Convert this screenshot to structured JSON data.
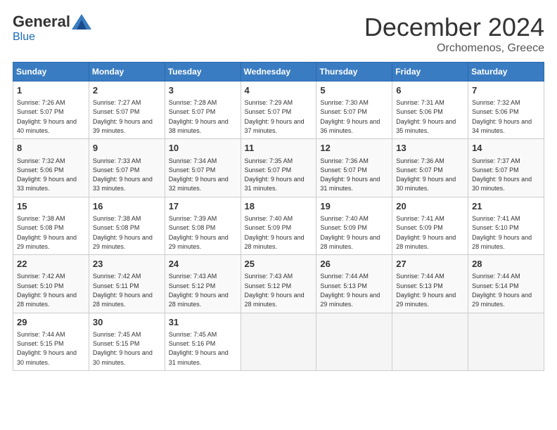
{
  "header": {
    "logo_general": "General",
    "logo_blue": "Blue",
    "month_title": "December 2024",
    "subtitle": "Orchomenos, Greece"
  },
  "days_of_week": [
    "Sunday",
    "Monday",
    "Tuesday",
    "Wednesday",
    "Thursday",
    "Friday",
    "Saturday"
  ],
  "weeks": [
    [
      {
        "day": 1,
        "sunrise": "7:26 AM",
        "sunset": "5:07 PM",
        "daylight": "9 hours and 40 minutes"
      },
      {
        "day": 2,
        "sunrise": "7:27 AM",
        "sunset": "5:07 PM",
        "daylight": "9 hours and 39 minutes"
      },
      {
        "day": 3,
        "sunrise": "7:28 AM",
        "sunset": "5:07 PM",
        "daylight": "9 hours and 38 minutes"
      },
      {
        "day": 4,
        "sunrise": "7:29 AM",
        "sunset": "5:07 PM",
        "daylight": "9 hours and 37 minutes"
      },
      {
        "day": 5,
        "sunrise": "7:30 AM",
        "sunset": "5:07 PM",
        "daylight": "9 hours and 36 minutes"
      },
      {
        "day": 6,
        "sunrise": "7:31 AM",
        "sunset": "5:06 PM",
        "daylight": "9 hours and 35 minutes"
      },
      {
        "day": 7,
        "sunrise": "7:32 AM",
        "sunset": "5:06 PM",
        "daylight": "9 hours and 34 minutes"
      }
    ],
    [
      {
        "day": 8,
        "sunrise": "7:32 AM",
        "sunset": "5:06 PM",
        "daylight": "9 hours and 33 minutes"
      },
      {
        "day": 9,
        "sunrise": "7:33 AM",
        "sunset": "5:07 PM",
        "daylight": "9 hours and 33 minutes"
      },
      {
        "day": 10,
        "sunrise": "7:34 AM",
        "sunset": "5:07 PM",
        "daylight": "9 hours and 32 minutes"
      },
      {
        "day": 11,
        "sunrise": "7:35 AM",
        "sunset": "5:07 PM",
        "daylight": "9 hours and 31 minutes"
      },
      {
        "day": 12,
        "sunrise": "7:36 AM",
        "sunset": "5:07 PM",
        "daylight": "9 hours and 31 minutes"
      },
      {
        "day": 13,
        "sunrise": "7:36 AM",
        "sunset": "5:07 PM",
        "daylight": "9 hours and 30 minutes"
      },
      {
        "day": 14,
        "sunrise": "7:37 AM",
        "sunset": "5:07 PM",
        "daylight": "9 hours and 30 minutes"
      }
    ],
    [
      {
        "day": 15,
        "sunrise": "7:38 AM",
        "sunset": "5:08 PM",
        "daylight": "9 hours and 29 minutes"
      },
      {
        "day": 16,
        "sunrise": "7:38 AM",
        "sunset": "5:08 PM",
        "daylight": "9 hours and 29 minutes"
      },
      {
        "day": 17,
        "sunrise": "7:39 AM",
        "sunset": "5:08 PM",
        "daylight": "9 hours and 29 minutes"
      },
      {
        "day": 18,
        "sunrise": "7:40 AM",
        "sunset": "5:09 PM",
        "daylight": "9 hours and 28 minutes"
      },
      {
        "day": 19,
        "sunrise": "7:40 AM",
        "sunset": "5:09 PM",
        "daylight": "9 hours and 28 minutes"
      },
      {
        "day": 20,
        "sunrise": "7:41 AM",
        "sunset": "5:09 PM",
        "daylight": "9 hours and 28 minutes"
      },
      {
        "day": 21,
        "sunrise": "7:41 AM",
        "sunset": "5:10 PM",
        "daylight": "9 hours and 28 minutes"
      }
    ],
    [
      {
        "day": 22,
        "sunrise": "7:42 AM",
        "sunset": "5:10 PM",
        "daylight": "9 hours and 28 minutes"
      },
      {
        "day": 23,
        "sunrise": "7:42 AM",
        "sunset": "5:11 PM",
        "daylight": "9 hours and 28 minutes"
      },
      {
        "day": 24,
        "sunrise": "7:43 AM",
        "sunset": "5:12 PM",
        "daylight": "9 hours and 28 minutes"
      },
      {
        "day": 25,
        "sunrise": "7:43 AM",
        "sunset": "5:12 PM",
        "daylight": "9 hours and 28 minutes"
      },
      {
        "day": 26,
        "sunrise": "7:44 AM",
        "sunset": "5:13 PM",
        "daylight": "9 hours and 29 minutes"
      },
      {
        "day": 27,
        "sunrise": "7:44 AM",
        "sunset": "5:13 PM",
        "daylight": "9 hours and 29 minutes"
      },
      {
        "day": 28,
        "sunrise": "7:44 AM",
        "sunset": "5:14 PM",
        "daylight": "9 hours and 29 minutes"
      }
    ],
    [
      {
        "day": 29,
        "sunrise": "7:44 AM",
        "sunset": "5:15 PM",
        "daylight": "9 hours and 30 minutes"
      },
      {
        "day": 30,
        "sunrise": "7:45 AM",
        "sunset": "5:15 PM",
        "daylight": "9 hours and 30 minutes"
      },
      {
        "day": 31,
        "sunrise": "7:45 AM",
        "sunset": "5:16 PM",
        "daylight": "9 hours and 31 minutes"
      },
      null,
      null,
      null,
      null
    ]
  ]
}
